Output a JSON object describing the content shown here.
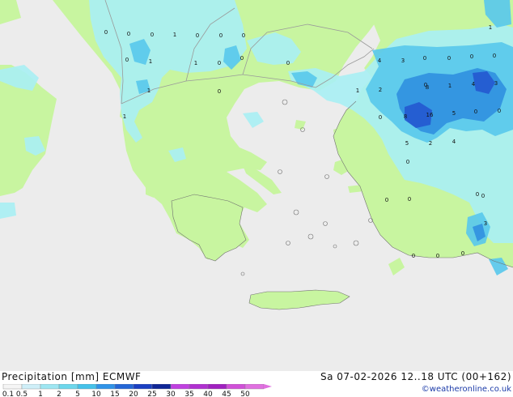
{
  "title": {
    "left": "Precipitation [mm]  ECMWF",
    "right": "Sa 07-02-2026 12..18 UTC (00+162)",
    "credit": "©weatheronline.co.uk"
  },
  "legend": {
    "labels": [
      "0.1",
      "0.5",
      "1",
      "2",
      "5",
      "10",
      "15",
      "20",
      "25",
      "30",
      "35",
      "40",
      "45",
      "50"
    ],
    "colors": [
      "#f5f5f5",
      "#cfeff8",
      "#9ee6f2",
      "#6dd7ec",
      "#44c2ea",
      "#2f93e8",
      "#2466d6",
      "#1a3fc2",
      "#0f2696",
      "#c040e0",
      "#b030d0",
      "#a020c0",
      "#d050d8",
      "#e070e0"
    ]
  },
  "colors": {
    "sea": "#ececec",
    "land": "#c8f5a0",
    "precip_light": "#a8f0f4",
    "precip_med": "#58c8ec",
    "precip_heavy": "#3090e0",
    "precip_vheavy": "#2458d0"
  },
  "map_labels": [
    "0",
    "0",
    "0",
    "1",
    "0",
    "0",
    "0",
    "0",
    "1",
    "1",
    "0",
    "1",
    "0",
    "1",
    "1",
    "0",
    "0",
    "4",
    "3",
    "0",
    "0",
    "0",
    "0",
    "1",
    "0",
    "0",
    "8",
    "1",
    "2",
    "4",
    "5",
    "3",
    "0",
    "8",
    "16",
    "5",
    "2",
    "4",
    "0",
    "0",
    "0",
    "0",
    "0",
    "0",
    "3",
    "0",
    "0",
    "0"
  ]
}
